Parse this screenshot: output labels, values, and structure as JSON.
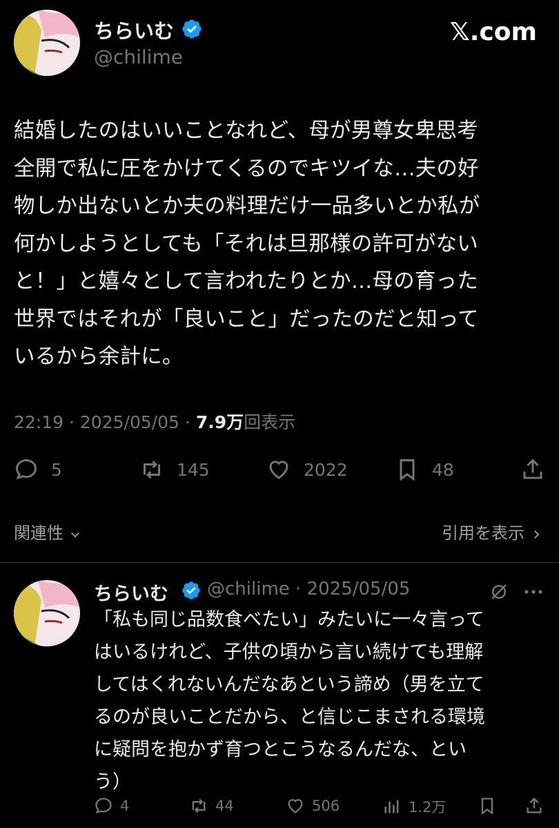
{
  "header": {
    "display_name": "ちらいむ",
    "handle": "@chilime",
    "site_label": "𝕏.com"
  },
  "tweet": {
    "lines": [
      "結婚したのはいいことなれど、母が男尊女卑思考",
      "全開で私に圧をかけてくるのでキツイな…夫の好",
      "物しか出ないとか夫の料理だけ一品多いとか私が",
      "何かしようとしても「それは旦那様の許可がない",
      "と！」と嬉々として言われたりとか…母の育った",
      "世界ではそれが「良いこと」だったのだと知って",
      "いるから余計に。"
    ],
    "time": "22:19",
    "date": "2025/05/05",
    "views_count": "7.9万",
    "views_label": "回表示",
    "replies": "5",
    "reposts": "145",
    "likes": "2022",
    "bookmarks": "48"
  },
  "related": {
    "left_label": "関連性",
    "right_label": "引用を表示"
  },
  "reply": {
    "display_name": "ちらいむ",
    "handle_date": "@chilime · 2025/05/05",
    "lines": [
      "「私も同じ品数食べたい」みたいに一々言って",
      "はいるけれど、子供の頃から言い続けても理解",
      "してはくれないんだなあという諦め（男を立て",
      "るのが良いことだから、と信じこまされる環境",
      "に疑問を抱かず育つとこうなるんだな、とい",
      "う）"
    ],
    "replies": "4",
    "reposts": "44",
    "likes": "506",
    "views": "1.2万"
  },
  "colors": {
    "background": "#000000",
    "text": "#e7e9ea",
    "muted": "#71767b",
    "verified": "#1d9bf0"
  }
}
